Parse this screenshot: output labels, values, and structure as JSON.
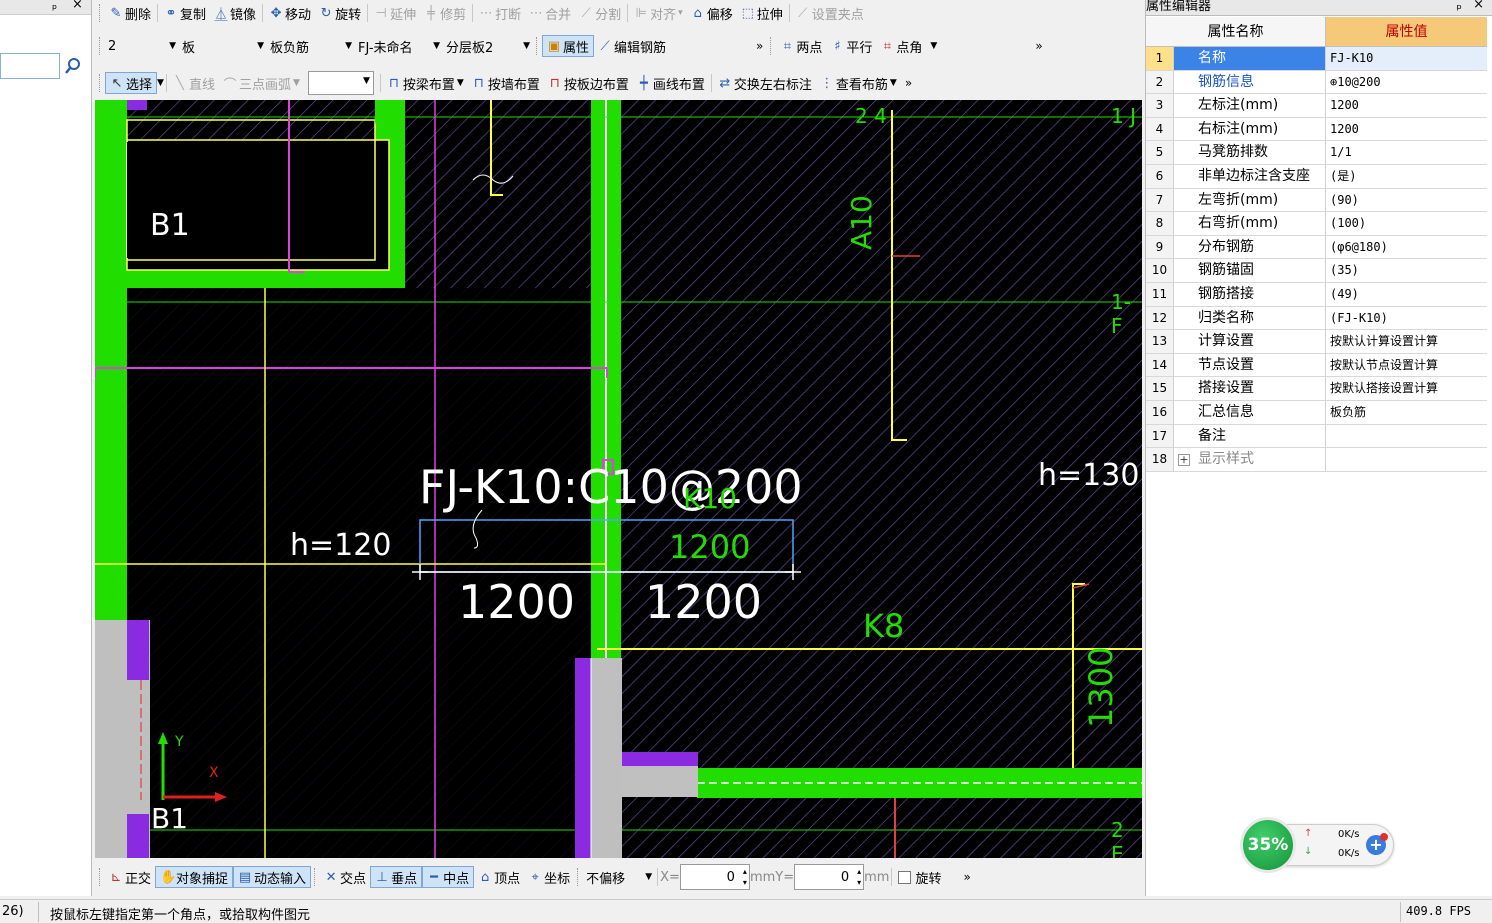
{
  "left_pane": {
    "pin": "ᵖ",
    "close": "×",
    "search_icon": "search-icon"
  },
  "toolbar1": {
    "items": [
      "删除",
      "复制",
      "镜像",
      "移动",
      "旋转",
      "延伸",
      "修剪",
      "打断",
      "合并",
      "分割",
      "对齐",
      "偏移",
      "拉伸",
      "设置夹点"
    ]
  },
  "toolbar2": {
    "floor": "2",
    "type": "板",
    "subtype": "板负筋",
    "name": "FJ-未命名",
    "layer": "分层板2",
    "attr_label": "属性",
    "edit_rebar": "编辑钢筋",
    "two_point": "两点",
    "parallel": "平行",
    "point_angle": "点角"
  },
  "toolbar3": {
    "select": "选择",
    "line": "直线",
    "arc": "三点画弧",
    "by_beam": "按梁布置",
    "by_wall": "按墙布置",
    "by_slab_edge": "按板边布置",
    "draw_line": "画线布置",
    "swap_marks": "交换左右标注",
    "view_layout": "查看布筋"
  },
  "canvas": {
    "labels": {
      "b1_top": "B1",
      "b1_bottom": "B1",
      "a10": "A10",
      "h120": "h=120",
      "h130": "h=130",
      "rebar": "FJ-K10:C10@200",
      "k10": "K10",
      "dim_1200_green": "1200",
      "dim_left": "1200",
      "dim_right": "1200",
      "k8": "K8",
      "dim_1300": "1300",
      "axis_24": "2 4",
      "axis_1j": "1 J",
      "axis_1f": "1-F",
      "axis_2e": "2 E"
    },
    "axis_y": "Y",
    "axis_x": "X"
  },
  "snap_bar": {
    "ortho": "正交",
    "obj_snap": "对象捕捉",
    "dyn_input": "动态输入",
    "intersect": "交点",
    "perp": "垂点",
    "mid": "中点",
    "vertex": "顶点",
    "coord": "坐标",
    "offset": "不偏移",
    "x_label": "X=",
    "x_value": "0",
    "mm1": "mm",
    "y_label": "Y=",
    "y_value": "0",
    "mm2": "mm",
    "rotate": "旋转"
  },
  "props": {
    "title": "属性编辑器",
    "header_name": "属性名称",
    "header_value": "属性值",
    "rows": [
      {
        "n": "1",
        "name": "名称",
        "value": "FJ-K10"
      },
      {
        "n": "2",
        "name": "钢筋信息",
        "value": "⊕10@200"
      },
      {
        "n": "3",
        "name": "左标注(mm)",
        "value": "1200"
      },
      {
        "n": "4",
        "name": "右标注(mm)",
        "value": "1200"
      },
      {
        "n": "5",
        "name": "马凳筋排数",
        "value": "1/1"
      },
      {
        "n": "6",
        "name": "非单边标注含支座",
        "value": "(是)"
      },
      {
        "n": "7",
        "name": "左弯折(mm)",
        "value": "(90)"
      },
      {
        "n": "8",
        "name": "右弯折(mm)",
        "value": "(100)"
      },
      {
        "n": "9",
        "name": "分布钢筋",
        "value": "(φ6@180)"
      },
      {
        "n": "10",
        "name": "钢筋锚固",
        "value": "(35)"
      },
      {
        "n": "11",
        "name": "钢筋搭接",
        "value": "(49)"
      },
      {
        "n": "12",
        "name": "归类名称",
        "value": "(FJ-K10)"
      },
      {
        "n": "13",
        "name": "计算设置",
        "value": "按默认计算设置计算"
      },
      {
        "n": "14",
        "name": "节点设置",
        "value": "按默认节点设置计算"
      },
      {
        "n": "15",
        "name": "搭接设置",
        "value": "按默认搭接设置计算"
      },
      {
        "n": "16",
        "name": "汇总信息",
        "value": "板负筋"
      },
      {
        "n": "17",
        "name": "备注",
        "value": ""
      },
      {
        "n": "18",
        "name": "显示样式",
        "value": ""
      }
    ]
  },
  "net_widget": {
    "percent": "35%",
    "up": "0K/s",
    "down": "0K/s"
  },
  "status": {
    "left": "26)",
    "message": "按鼠标左键指定第一个角点，或拾取构件图元",
    "fps": "409.8 FPS"
  }
}
